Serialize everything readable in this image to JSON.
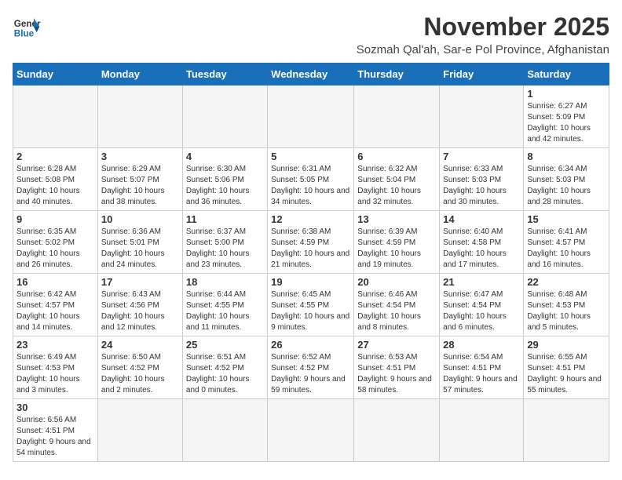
{
  "logo": {
    "text_general": "General",
    "text_blue": "Blue"
  },
  "header": {
    "month_year": "November 2025",
    "subtitle": "Sozmah Qal'ah, Sar-e Pol Province, Afghanistan"
  },
  "weekdays": [
    "Sunday",
    "Monday",
    "Tuesday",
    "Wednesday",
    "Thursday",
    "Friday",
    "Saturday"
  ],
  "days": {
    "1": {
      "sunrise": "6:27 AM",
      "sunset": "5:09 PM",
      "daylight_h": "10",
      "daylight_m": "42"
    },
    "2": {
      "sunrise": "6:28 AM",
      "sunset": "5:08 PM",
      "daylight_h": "10",
      "daylight_m": "40"
    },
    "3": {
      "sunrise": "6:29 AM",
      "sunset": "5:07 PM",
      "daylight_h": "10",
      "daylight_m": "38"
    },
    "4": {
      "sunrise": "6:30 AM",
      "sunset": "5:06 PM",
      "daylight_h": "10",
      "daylight_m": "36"
    },
    "5": {
      "sunrise": "6:31 AM",
      "sunset": "5:05 PM",
      "daylight_h": "10",
      "daylight_m": "34"
    },
    "6": {
      "sunrise": "6:32 AM",
      "sunset": "5:04 PM",
      "daylight_h": "10",
      "daylight_m": "32"
    },
    "7": {
      "sunrise": "6:33 AM",
      "sunset": "5:03 PM",
      "daylight_h": "10",
      "daylight_m": "30"
    },
    "8": {
      "sunrise": "6:34 AM",
      "sunset": "5:03 PM",
      "daylight_h": "10",
      "daylight_m": "28"
    },
    "9": {
      "sunrise": "6:35 AM",
      "sunset": "5:02 PM",
      "daylight_h": "10",
      "daylight_m": "26"
    },
    "10": {
      "sunrise": "6:36 AM",
      "sunset": "5:01 PM",
      "daylight_h": "10",
      "daylight_m": "24"
    },
    "11": {
      "sunrise": "6:37 AM",
      "sunset": "5:00 PM",
      "daylight_h": "10",
      "daylight_m": "23"
    },
    "12": {
      "sunrise": "6:38 AM",
      "sunset": "4:59 PM",
      "daylight_h": "10",
      "daylight_m": "21"
    },
    "13": {
      "sunrise": "6:39 AM",
      "sunset": "4:59 PM",
      "daylight_h": "10",
      "daylight_m": "19"
    },
    "14": {
      "sunrise": "6:40 AM",
      "sunset": "4:58 PM",
      "daylight_h": "10",
      "daylight_m": "17"
    },
    "15": {
      "sunrise": "6:41 AM",
      "sunset": "4:57 PM",
      "daylight_h": "10",
      "daylight_m": "16"
    },
    "16": {
      "sunrise": "6:42 AM",
      "sunset": "4:57 PM",
      "daylight_h": "10",
      "daylight_m": "14"
    },
    "17": {
      "sunrise": "6:43 AM",
      "sunset": "4:56 PM",
      "daylight_h": "10",
      "daylight_m": "12"
    },
    "18": {
      "sunrise": "6:44 AM",
      "sunset": "4:55 PM",
      "daylight_h": "10",
      "daylight_m": "11"
    },
    "19": {
      "sunrise": "6:45 AM",
      "sunset": "4:55 PM",
      "daylight_h": "10",
      "daylight_m": "9"
    },
    "20": {
      "sunrise": "6:46 AM",
      "sunset": "4:54 PM",
      "daylight_h": "10",
      "daylight_m": "8"
    },
    "21": {
      "sunrise": "6:47 AM",
      "sunset": "4:54 PM",
      "daylight_h": "10",
      "daylight_m": "6"
    },
    "22": {
      "sunrise": "6:48 AM",
      "sunset": "4:53 PM",
      "daylight_h": "10",
      "daylight_m": "5"
    },
    "23": {
      "sunrise": "6:49 AM",
      "sunset": "4:53 PM",
      "daylight_h": "10",
      "daylight_m": "3"
    },
    "24": {
      "sunrise": "6:50 AM",
      "sunset": "4:52 PM",
      "daylight_h": "10",
      "daylight_m": "2"
    },
    "25": {
      "sunrise": "6:51 AM",
      "sunset": "4:52 PM",
      "daylight_h": "10",
      "daylight_m": "0"
    },
    "26": {
      "sunrise": "6:52 AM",
      "sunset": "4:52 PM",
      "daylight_h": "9",
      "daylight_m": "59"
    },
    "27": {
      "sunrise": "6:53 AM",
      "sunset": "4:51 PM",
      "daylight_h": "9",
      "daylight_m": "58"
    },
    "28": {
      "sunrise": "6:54 AM",
      "sunset": "4:51 PM",
      "daylight_h": "9",
      "daylight_m": "57"
    },
    "29": {
      "sunrise": "6:55 AM",
      "sunset": "4:51 PM",
      "daylight_h": "9",
      "daylight_m": "55"
    },
    "30": {
      "sunrise": "6:56 AM",
      "sunset": "4:51 PM",
      "daylight_h": "9",
      "daylight_m": "54"
    }
  }
}
